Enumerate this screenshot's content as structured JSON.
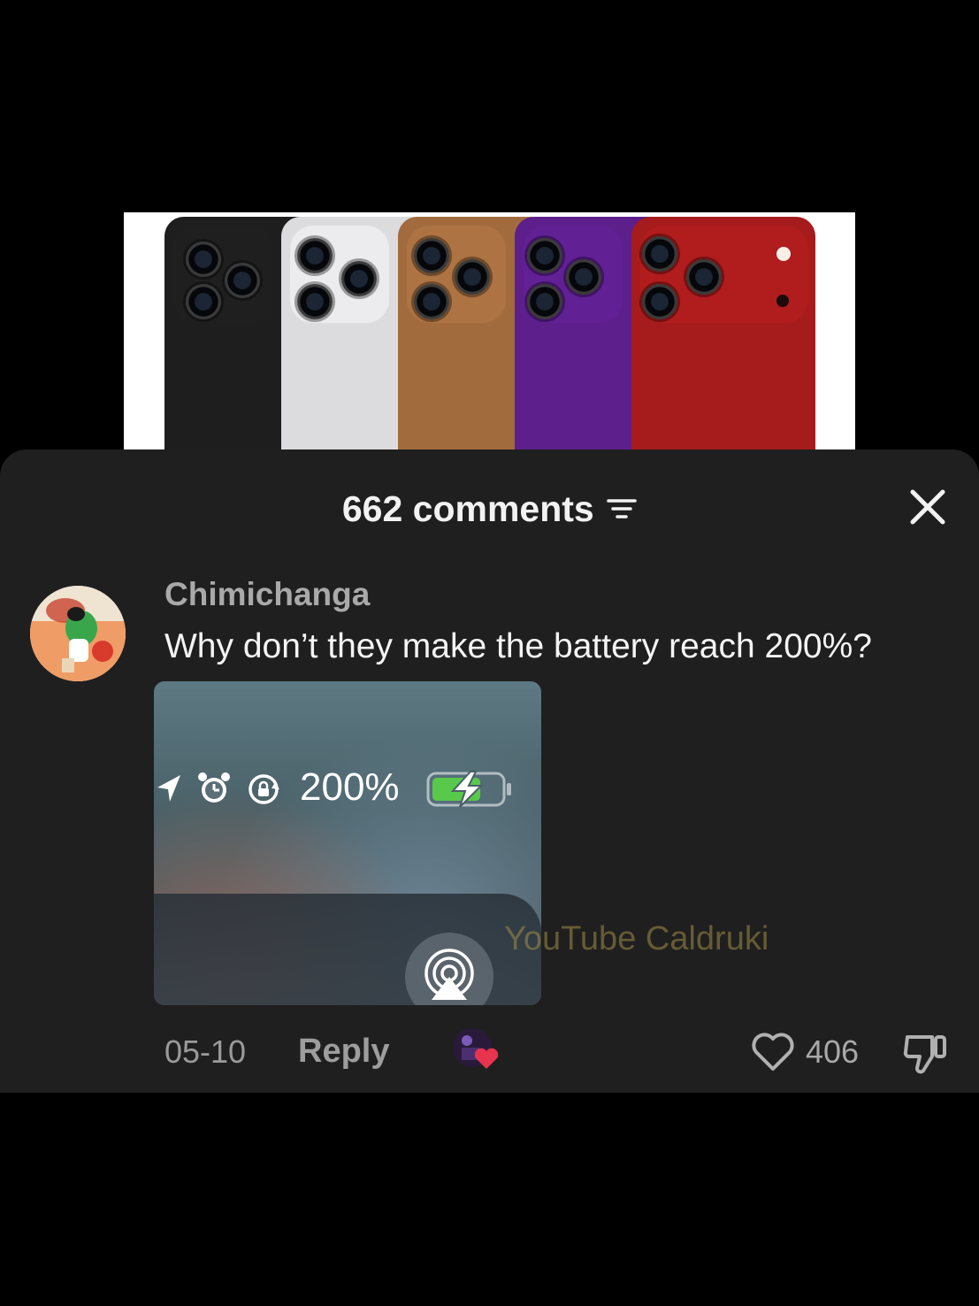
{
  "product_image": {
    "phone_colors": [
      "#1e1e1e",
      "#dcdcde",
      "#a26b3e",
      "#5c1f8c",
      "#a61b1c"
    ]
  },
  "comments_sheet": {
    "count_label": "662 comments",
    "filter_icon": "filter-icon",
    "close_icon": "close-icon"
  },
  "comment": {
    "username": "Chimichanga",
    "text": "Why don’t they make the battery reach 200%?",
    "image": {
      "status_battery": "200%",
      "icons": [
        "location-arrow-icon",
        "alarm-icon",
        "rotation-lock-icon",
        "battery-charging-icon",
        "airplay-icon"
      ]
    },
    "timestamp": "05-10",
    "reply_label": "Reply",
    "likes": "406",
    "creator_liked": true
  },
  "watermark": "YouTube Caldruki",
  "colors": {
    "sheet_bg": "#1f1f1f",
    "like_heart": "#e8344e",
    "battery_green": "#59c94b"
  }
}
